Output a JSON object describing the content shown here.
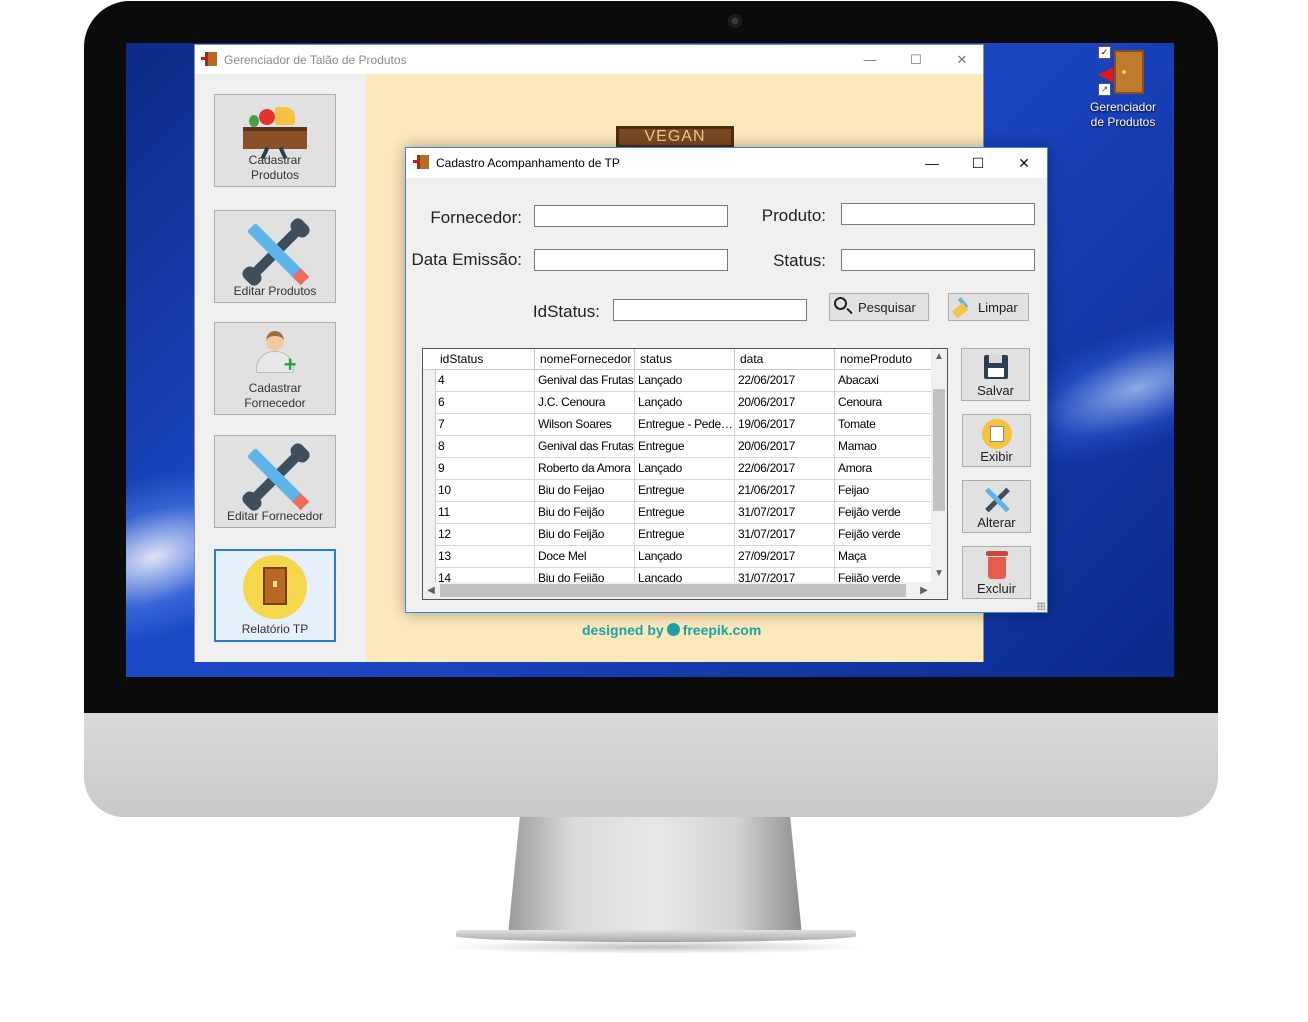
{
  "desktop": {
    "shortcut_label_line1": "Gerenciador",
    "shortcut_label_line2": "de Produtos"
  },
  "main_window": {
    "title": "Gerenciador de Talão de Produtos",
    "controls": {
      "minimize": "—",
      "maximize": "☐",
      "close": "✕"
    },
    "nav": [
      {
        "label_line1": "Cadastrar",
        "label_line2": "Produtos",
        "icon": "crate-food-icon"
      },
      {
        "label_line1": "Editar Produtos",
        "label_line2": "",
        "icon": "pencil-wrench-icon"
      },
      {
        "label_line1": "Cadastrar",
        "label_line2": "Fornecedor",
        "icon": "add-user-icon"
      },
      {
        "label_line1": "Editar Fornecedor",
        "label_line2": "",
        "icon": "pencil-wrench-icon"
      },
      {
        "label_line1": "Relatório TP",
        "label_line2": "",
        "icon": "report-icon",
        "active": true
      }
    ],
    "sign_text": "VEGAN FOOD",
    "credit": {
      "prefix": "designed by",
      "brand": "freepik.com"
    }
  },
  "dialog": {
    "title": "Cadastro Acompanhamento de TP",
    "controls": {
      "minimize": "—",
      "maximize": "☐",
      "close": "✕"
    },
    "fields": {
      "fornecedor": {
        "label": "Fornecedor:",
        "value": ""
      },
      "produto": {
        "label": "Produto:",
        "value": ""
      },
      "data_emissao": {
        "label": "Data Emissão:",
        "value": ""
      },
      "status": {
        "label": "Status:",
        "value": ""
      },
      "idstatus": {
        "label": "IdStatus:",
        "value": ""
      }
    },
    "buttons": {
      "pesquisar": "Pesquisar",
      "limpar": "Limpar",
      "salvar": "Salvar",
      "exibir": "Exibir",
      "alterar": "Alterar",
      "excluir": "Excluir"
    },
    "grid": {
      "columns": [
        "idStatus",
        "nomeFornecedor",
        "status",
        "data",
        "nomeProduto"
      ],
      "rows": [
        [
          "4",
          "Genival das Frutas",
          "Lançado",
          "22/06/2017",
          "Abacaxi"
        ],
        [
          "6",
          "J.C. Cenoura",
          "Lançado",
          "20/06/2017",
          "Cenoura"
        ],
        [
          "7",
          "Wilson Soares",
          "Entregue - Pedente",
          "19/06/2017",
          "Tomate"
        ],
        [
          "8",
          "Genival das Frutas",
          "Entregue",
          "20/06/2017",
          "Mamao"
        ],
        [
          "9",
          "Roberto da Amora",
          "Lançado",
          "22/06/2017",
          "Amora"
        ],
        [
          "10",
          "Biu do Feijao",
          "Entregue",
          "21/06/2017",
          "Feijao"
        ],
        [
          "11",
          "Biu do Feijão",
          "Entregue",
          "31/07/2017",
          "Feijão verde"
        ],
        [
          "12",
          "Biu do Feijão",
          "Entregue",
          "31/07/2017",
          "Feijão verde"
        ],
        [
          "13",
          "Doce Mel",
          "Lançado",
          "27/09/2017",
          "Maça"
        ],
        [
          "14",
          "Biu do Feijão",
          "Lançado",
          "31/07/2017",
          "Feijão verde"
        ]
      ]
    }
  }
}
